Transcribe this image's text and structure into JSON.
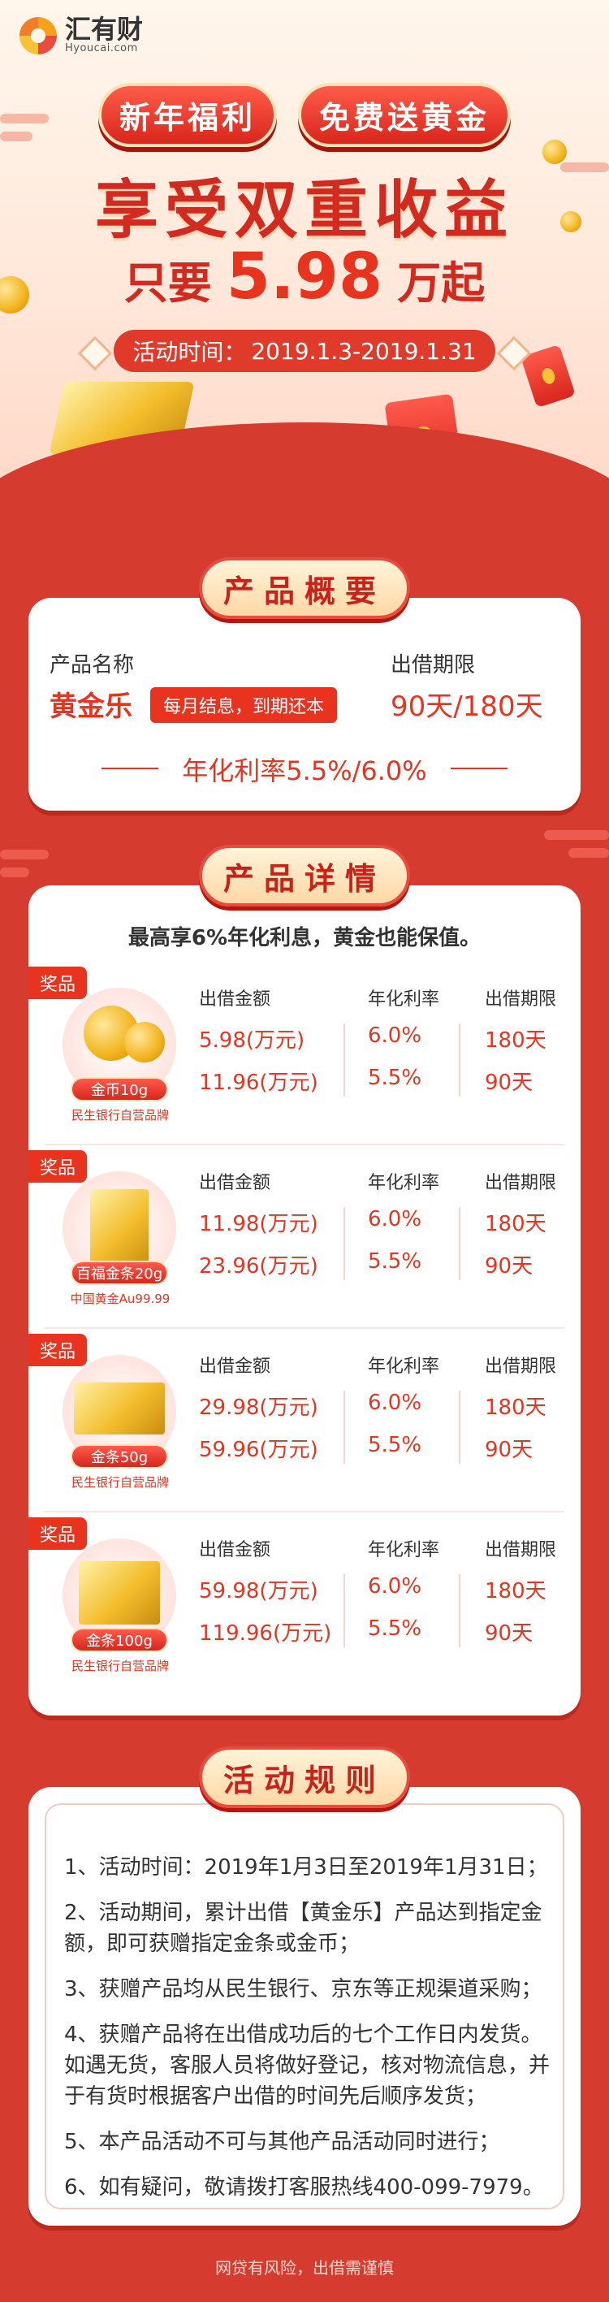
{
  "brand": {
    "name": "汇有财",
    "domain": "Hyoucai.com"
  },
  "hero": {
    "ribbons": [
      "新年福利",
      "免费送黄金"
    ],
    "headline": "享受双重收益",
    "sub_prefix": "只要",
    "sub_amount": "5.98",
    "sub_suffix": "万起",
    "activity_time_label": "活动时间：",
    "activity_time_value": "2019.1.3-2019.1.31"
  },
  "overview": {
    "title": "产品概要",
    "name_label": "产品名称",
    "name_value": "黄金乐",
    "tag": "每月结息，到期还本",
    "term_label": "出借期限",
    "term_value": "90天/180天",
    "rate": "年化利率5.5%/6.0%"
  },
  "details": {
    "title": "产品详情",
    "intro": "最高享6%年化利息，黄金也能保值。",
    "headers": [
      "出借金额",
      "年化利率",
      "出借期限"
    ],
    "prizes": [
      {
        "tag": "奖品",
        "badge": "金币10g",
        "sub": "民生银行自营品牌",
        "rows": [
          [
            "5.98(万元)",
            "6.0%",
            "180天"
          ],
          [
            "11.96(万元)",
            "5.5%",
            "90天"
          ]
        ]
      },
      {
        "tag": "奖品",
        "badge": "百福金条20g",
        "sub": "中国黄金Au99.99",
        "rows": [
          [
            "11.98(万元)",
            "6.0%",
            "180天"
          ],
          [
            "23.96(万元)",
            "5.5%",
            "90天"
          ]
        ]
      },
      {
        "tag": "奖品",
        "badge": "金条50g",
        "sub": "民生银行自营品牌",
        "rows": [
          [
            "29.98(万元)",
            "6.0%",
            "180天"
          ],
          [
            "59.96(万元)",
            "5.5%",
            "90天"
          ]
        ]
      },
      {
        "tag": "奖品",
        "badge": "金条100g",
        "sub": "民生银行自营品牌",
        "rows": [
          [
            "59.98(万元)",
            "6.0%",
            "180天"
          ],
          [
            "119.96(万元)",
            "5.5%",
            "90天"
          ]
        ]
      }
    ]
  },
  "rules": {
    "title": "活动规则",
    "items": [
      "1、活动时间：2019年1月3日至2019年1月31日；",
      "2、活动期间，累计出借【黄金乐】产品达到指定金额，即可获赠指定金条或金币；",
      "3、获赠产品均从民生银行、京东等正规渠道采购；",
      "4、获赠产品将在出借成功后的七个工作日内发货。如遇无货，客服人员将做好登记，核对物流信息，并于有货时根据客户出借的时间先后顺序发货；",
      "5、本产品活动不可与其他产品活动同时进行；",
      "6、如有疑问，敬请拨打客服热线400-099-7979。"
    ]
  },
  "footer": {
    "note": "网贷有风险，出借需谨慎"
  },
  "colors": {
    "primary": "#d63b2f",
    "accent": "#e8341f",
    "gold": "#f4be2d"
  }
}
